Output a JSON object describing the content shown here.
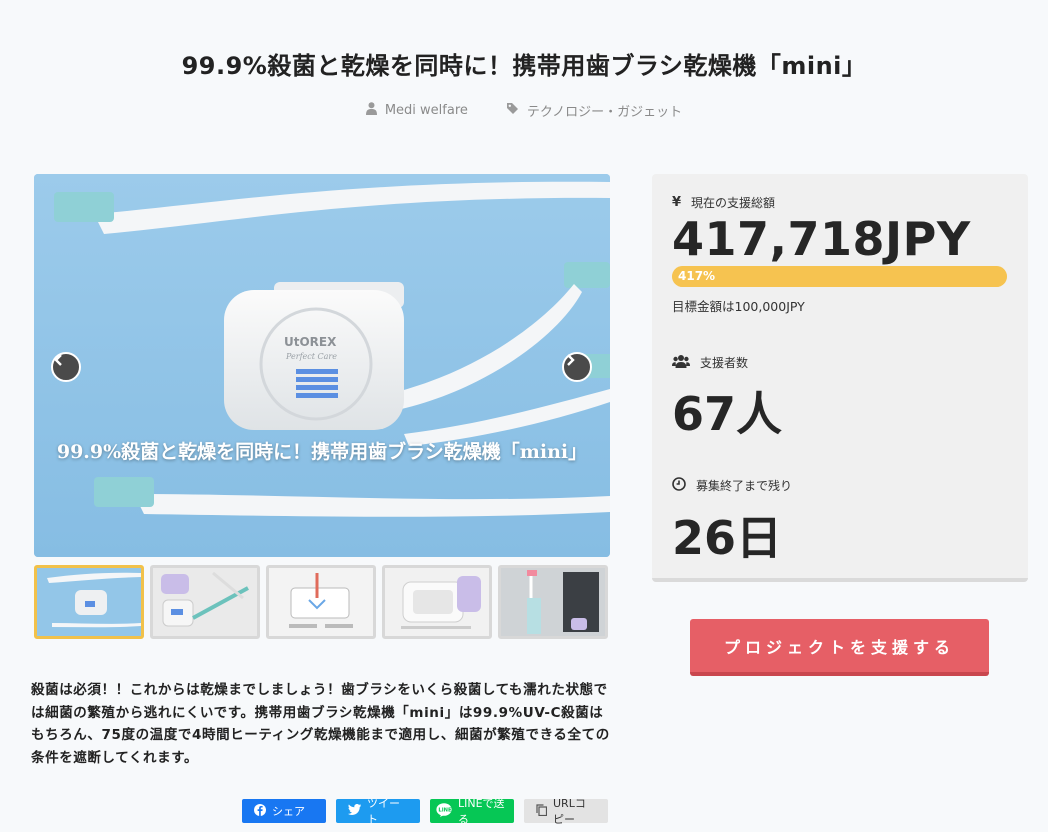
{
  "page": {
    "title": "99.9%殺菌と乾燥を同時に！携帯用歯ブラシ乾燥機「mini」",
    "author": "Medi welfare",
    "category": "テクノロジー・ガジェット"
  },
  "hero": {
    "caption": "99.9%殺菌と乾燥を同時に！携帯用歯ブラシ乾燥機「mini」",
    "brand": "UtOREX",
    "brand_sub": "Perfect Care",
    "icons": {
      "prev": "chevron-left-icon",
      "next": "chevron-right-icon"
    }
  },
  "thumbnails": [
    {
      "name": "thumb-1",
      "active": true
    },
    {
      "name": "thumb-2",
      "active": false
    },
    {
      "name": "thumb-3",
      "active": false
    },
    {
      "name": "thumb-4",
      "active": false
    },
    {
      "name": "thumb-5",
      "active": false
    }
  ],
  "description": "殺菌は必須！！これからは乾燥までしましょう！歯ブラシをいくら殺菌しても濡れた状態では細菌の繁殖から逃れにくいです。携帯用歯ブラシ乾燥機「mini」は99.9%UV-C殺菌はもちろん、75度の温度で4時間ヒーティング乾燥機能まで適用し、細菌が繁殖できる全ての条件を遮断してくれます。",
  "share": {
    "facebook": "シェア",
    "twitter": "ツイート",
    "line": "LINEで送る",
    "url": "URLコピー"
  },
  "stats": {
    "amount_label": "現在の支援総額",
    "amount_value": "417,718JPY",
    "percent_label": "417%",
    "percent_value": 417,
    "goal_text": "目標金額は100,000JPY",
    "backers_label": "支援者数",
    "backers_value": "67人",
    "remaining_label": "募集終了まで残り",
    "remaining_value": "26日"
  },
  "cta": {
    "label": "プロジェクトを支援する"
  },
  "colors": {
    "cta": "#e65f66",
    "progress": "#f6c350",
    "accent_border": "#f1c14a"
  }
}
